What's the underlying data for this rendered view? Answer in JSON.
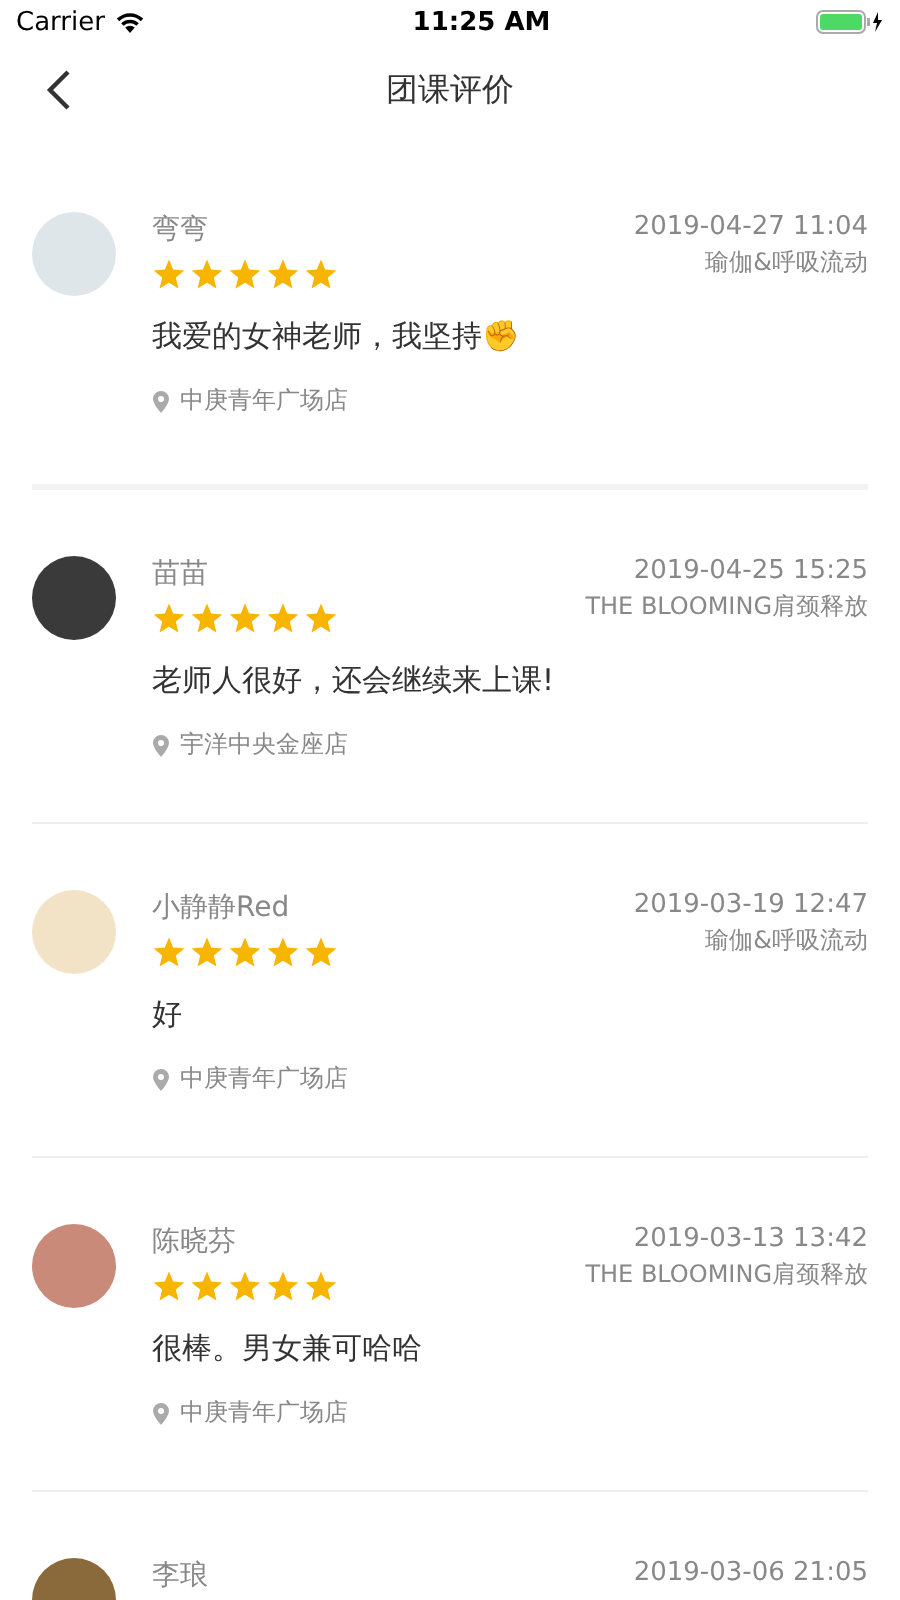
{
  "status_bar": {
    "carrier": "Carrier",
    "time": "11:25 AM"
  },
  "nav": {
    "title": "团课评价"
  },
  "reviews": [
    {
      "name": "弯弯",
      "stars": 5,
      "date": "2019-04-27 11:04",
      "course": "瑜伽&呼吸流动",
      "text": "我爱的女神老师，我坚持✊",
      "store": "中庚青年广场店"
    },
    {
      "name": "苗苗",
      "stars": 5,
      "date": "2019-04-25 15:25",
      "course": "THE BLOOMING肩颈释放",
      "text": "老师人很好，还会继续来上课!",
      "store": "宇洋中央金座店"
    },
    {
      "name": "小静静Red",
      "stars": 5,
      "date": "2019-03-19 12:47",
      "course": "瑜伽&呼吸流动",
      "text": "好",
      "store": "中庚青年广场店"
    },
    {
      "name": "陈晓芬",
      "stars": 5,
      "date": "2019-03-13 13:42",
      "course": "THE BLOOMING肩颈释放",
      "text": "很棒。男女兼可哈哈",
      "store": "中庚青年广场店"
    },
    {
      "name": "李琅",
      "date": "2019-03-06 21:05"
    }
  ]
}
